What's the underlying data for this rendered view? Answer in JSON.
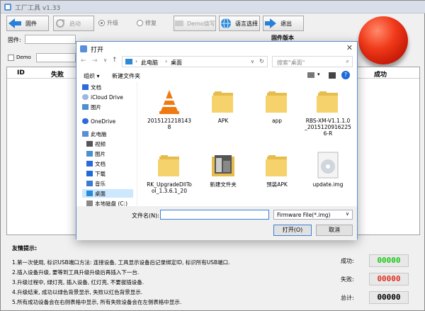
{
  "app": {
    "title": "工厂工具 v1.33",
    "toolbar": {
      "firmware_btn": "固件",
      "start_btn": "启动",
      "upgrade_radio": "升级",
      "repair_radio": "修复",
      "demo_btn": "Demo烧写",
      "language_btn": "语言选择",
      "exit_btn": "退出"
    },
    "firmware_label": "固件:",
    "firmware_version_label": "固件版本",
    "demo_label": "Demo",
    "grid": {
      "col_id": "ID",
      "col_fail": "失败",
      "col_success": "成功"
    },
    "info": {
      "title": "友情提示:",
      "lines": [
        "1.第一次使用, 标识USB端口方法: 连接设备, 工具显示设备后记录绑定ID, 标识所有USB端口.",
        "2.插入设备升级, 要等到工具升级升级后再插入下一台.",
        "3.升级过程中, 绿灯亮, 插入设备, 红灯亮, 不要拔插设备.",
        "4.升级结束, 成功以绿色背景显示, 失败以红色背景显示.",
        "5.所有成功设备会在右侧表格中显示, 所有失败设备会在左侧表格中显示."
      ]
    },
    "stats": {
      "success_label": "成功:",
      "success_value": "00000",
      "fail_label": "失败:",
      "fail_value": "00000",
      "total_label": "总计:",
      "total_value": "00000"
    }
  },
  "dialog": {
    "title": "打开",
    "breadcrumb": [
      "此电脑",
      "桌面"
    ],
    "search_placeholder": "搜索\"桌面\"",
    "organize": "组织 ▾",
    "new_folder": "新建文件夹",
    "nav": [
      {
        "label": "文档",
        "icon": "document-icon"
      },
      {
        "label": "iCloud Drive",
        "icon": "cloud-icon"
      },
      {
        "label": "图片",
        "icon": "picture-icon"
      },
      {
        "label": "OneDrive",
        "icon": "onedrive-icon"
      },
      {
        "label": "此电脑",
        "icon": "computer-icon"
      },
      {
        "label": "视频",
        "icon": "video-icon"
      },
      {
        "label": "图片",
        "icon": "picture-icon"
      },
      {
        "label": "文档",
        "icon": "document-icon"
      },
      {
        "label": "下载",
        "icon": "download-icon"
      },
      {
        "label": "音乐",
        "icon": "music-icon"
      },
      {
        "label": "桌面",
        "icon": "desktop-icon"
      },
      {
        "label": "本地磁盘 (C:)",
        "icon": "disk-icon"
      }
    ],
    "files": [
      {
        "name": "20151212181438",
        "icon": "vlc-icon"
      },
      {
        "name": "APK",
        "icon": "folder-icon"
      },
      {
        "name": "app",
        "icon": "folder-icon"
      },
      {
        "name": "RBS-XM-V1.1.1.0_20151209162256-R",
        "icon": "folder-icon"
      },
      {
        "name": "RK_UpgradeDllTool_1.3.6.1_20",
        "icon": "folder-icon"
      },
      {
        "name": "新建文件夹",
        "icon": "photo-folder-icon"
      },
      {
        "name": "预装APK",
        "icon": "folder-icon"
      },
      {
        "name": "update.img",
        "icon": "disc-image-icon"
      }
    ],
    "filename_label": "文件名(N):",
    "filename_value": "",
    "filter": "Firmware File(*.img)",
    "open_btn": "打开(O)",
    "cancel_btn": "取消"
  },
  "colors": {
    "success_green": "#1ec81e",
    "fail_red": "#e03020",
    "selection_blue": "#cce8ff",
    "folder_yellow": "#f5d26b"
  }
}
